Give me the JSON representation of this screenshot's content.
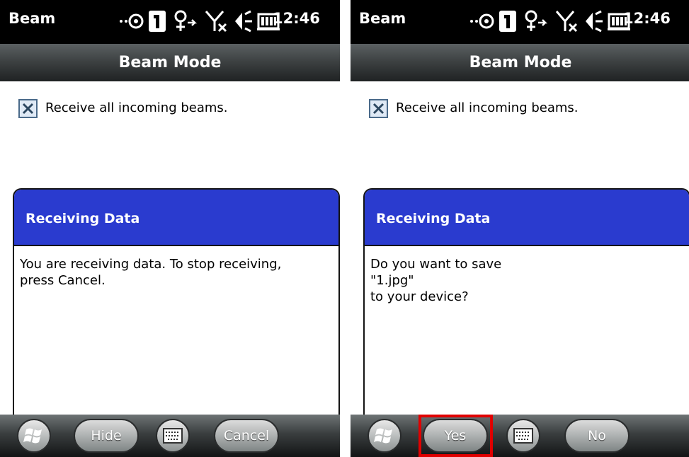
{
  "screens": [
    {
      "status": {
        "app": "Beam",
        "time": "12:46"
      },
      "header": {
        "title": "Beam Mode"
      },
      "checkbox": {
        "label": "Receive all incoming beams.",
        "checked": true
      },
      "dialog": {
        "title": "Receiving Data",
        "lines": [
          "You are receiving data. To stop receiving,",
          "press Cancel."
        ]
      },
      "softkeys": {
        "left": "Hide",
        "right": "Cancel"
      }
    },
    {
      "status": {
        "app": "Beam",
        "time": "12:46"
      },
      "header": {
        "title": "Beam Mode"
      },
      "checkbox": {
        "label": "Receive all incoming beams.",
        "checked": true
      },
      "dialog": {
        "title": "Receiving Data",
        "lines": [
          "Do you want to save",
          "\"1.jpg\"",
          "to your device?"
        ]
      },
      "softkeys": {
        "left": "Yes",
        "right": "No"
      }
    }
  ],
  "colors": {
    "dialog_title_bg": "#2a3bcf",
    "highlight": "#e00000",
    "checkbox_bg": "#dfe9f5"
  },
  "icons": [
    "sync-icon",
    "sim-1-icon",
    "connectivity-icon",
    "signal-off-icon",
    "volume-icon",
    "battery-icon",
    "windows-start-icon",
    "keyboard-icon",
    "checkbox-x-icon"
  ]
}
